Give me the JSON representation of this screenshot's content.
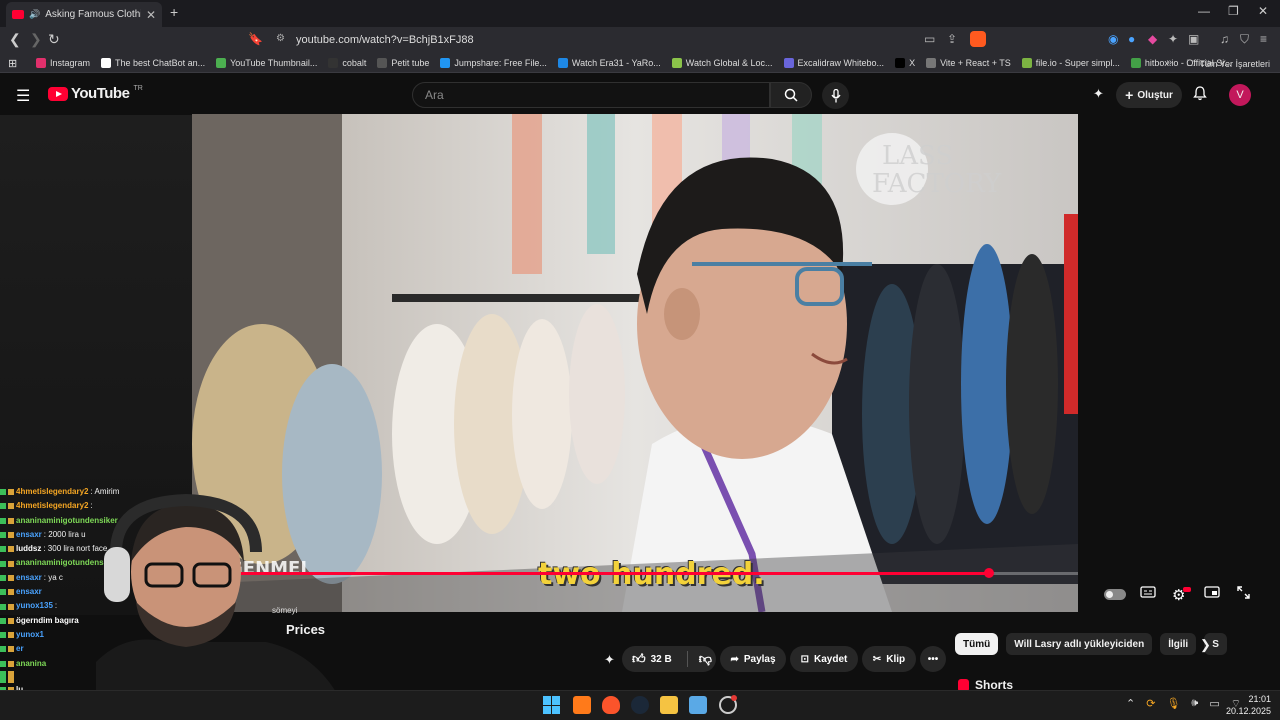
{
  "browser": {
    "tab_title": "Asking Famous Clothing Fact",
    "url": "youtube.com/watch?v=BchjB1xFJ88",
    "bookmarks": [
      {
        "label": "Instagram",
        "color": "#e1306c"
      },
      {
        "label": "The best ChatBot an...",
        "color": "#ffffff"
      },
      {
        "label": "YouTube Thumbnail...",
        "color": "#4caf50"
      },
      {
        "label": "cobalt",
        "color": "#333333"
      },
      {
        "label": "Petit tube",
        "color": "#555555"
      },
      {
        "label": "Jumpshare: Free File...",
        "color": "#2196f3"
      },
      {
        "label": "Watch Era31 - YaRo...",
        "color": "#1e88e5"
      },
      {
        "label": "Watch Global & Loc...",
        "color": "#8bc34a"
      },
      {
        "label": "Excalidraw Whitebo...",
        "color": "#6965db"
      },
      {
        "label": "X",
        "color": "#000000"
      },
      {
        "label": "Vite + React + TS",
        "color": "#777777"
      },
      {
        "label": "file.io - Super simpl...",
        "color": "#7cb342"
      },
      {
        "label": "hitbox.io - Official Si...",
        "color": "#43a047"
      }
    ],
    "all_bookmarks": "Tüm Yer İşaretleri"
  },
  "youtube": {
    "logo_text": "YouTube",
    "country_code": "TR",
    "search_placeholder": "Ara",
    "create_label": "Oluştur",
    "avatar_letter": "V"
  },
  "video": {
    "subtitle": "two hundred.",
    "overlay_text": "GENMEI",
    "progress_fraction": 0.9,
    "title_fragment": "Prices"
  },
  "actions": {
    "like_count": "32 B",
    "share": "Paylaş",
    "save": "Kaydet",
    "clip": "Klip"
  },
  "chips": [
    {
      "label": "Tümü",
      "active": true
    },
    {
      "label": "Will Lasry adlı yükleyiciden",
      "active": false
    },
    {
      "label": "İlgili",
      "active": false
    },
    {
      "label": "S",
      "active": false
    }
  ],
  "shorts_label": "Shorts",
  "chat": [
    {
      "name": "4hmetislegendary2",
      "msg": ": Amirim",
      "color": "#f5a623"
    },
    {
      "name": "4hmetislegendary2",
      "msg": ":",
      "color": "#f5a623"
    },
    {
      "name": "ananinaminigotundensiker",
      "msg": "",
      "color": "#7ed957"
    },
    {
      "name": "ensaxr",
      "msg": ": 2000 lira u",
      "color": "#4aa3ff"
    },
    {
      "name": "luddsz",
      "msg": ": 300 lira nort face",
      "color": "#ffffff"
    },
    {
      "name": "ananinaminigotundens",
      "msg": "",
      "color": "#7ed957"
    },
    {
      "name": "ensaxr",
      "msg": ": ya c",
      "color": "#4aa3ff"
    },
    {
      "name": "ensaxr",
      "msg": "",
      "color": "#4aa3ff"
    },
    {
      "name": "yunox135",
      "msg": ":",
      "color": "#4aa3ff"
    },
    {
      "name": "ögerndim bagıra",
      "msg": "",
      "color": "#ffffff"
    },
    {
      "name": "yunox1",
      "msg": "",
      "color": "#4aa3ff"
    },
    {
      "name": "er",
      "msg": "",
      "color": "#4aa3ff"
    },
    {
      "name": "ananina",
      "msg": "",
      "color": "#7ed957"
    },
    {
      "name": "",
      "msg": "",
      "color": "#ffffff"
    },
    {
      "name": "",
      "msg": "",
      "color": "#ffffff"
    },
    {
      "name": "lu",
      "msg": "",
      "color": "#ffffff"
    }
  ],
  "chat_overlay_fragment": "sömeyi",
  "clock": {
    "time": "21:01",
    "date": "20.12.2025"
  }
}
